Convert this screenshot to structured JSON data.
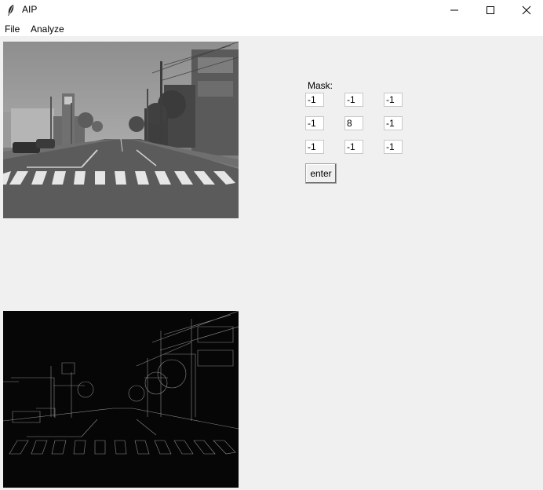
{
  "window": {
    "title": "AIP",
    "icon": "feather-icon"
  },
  "menu": {
    "items": [
      {
        "label": "File"
      },
      {
        "label": "Analyze"
      }
    ]
  },
  "images": {
    "original": {
      "kind": "grayscale street photo",
      "icon": "image"
    },
    "filtered": {
      "kind": "edge-detected street photo",
      "icon": "image"
    }
  },
  "mask": {
    "label": "Mask:",
    "cells": [
      [
        "-1",
        "-1",
        "-1"
      ],
      [
        "-1",
        "8",
        "-1"
      ],
      [
        "-1",
        "-1",
        "-1"
      ]
    ]
  },
  "enter_button": {
    "label": "enter"
  }
}
